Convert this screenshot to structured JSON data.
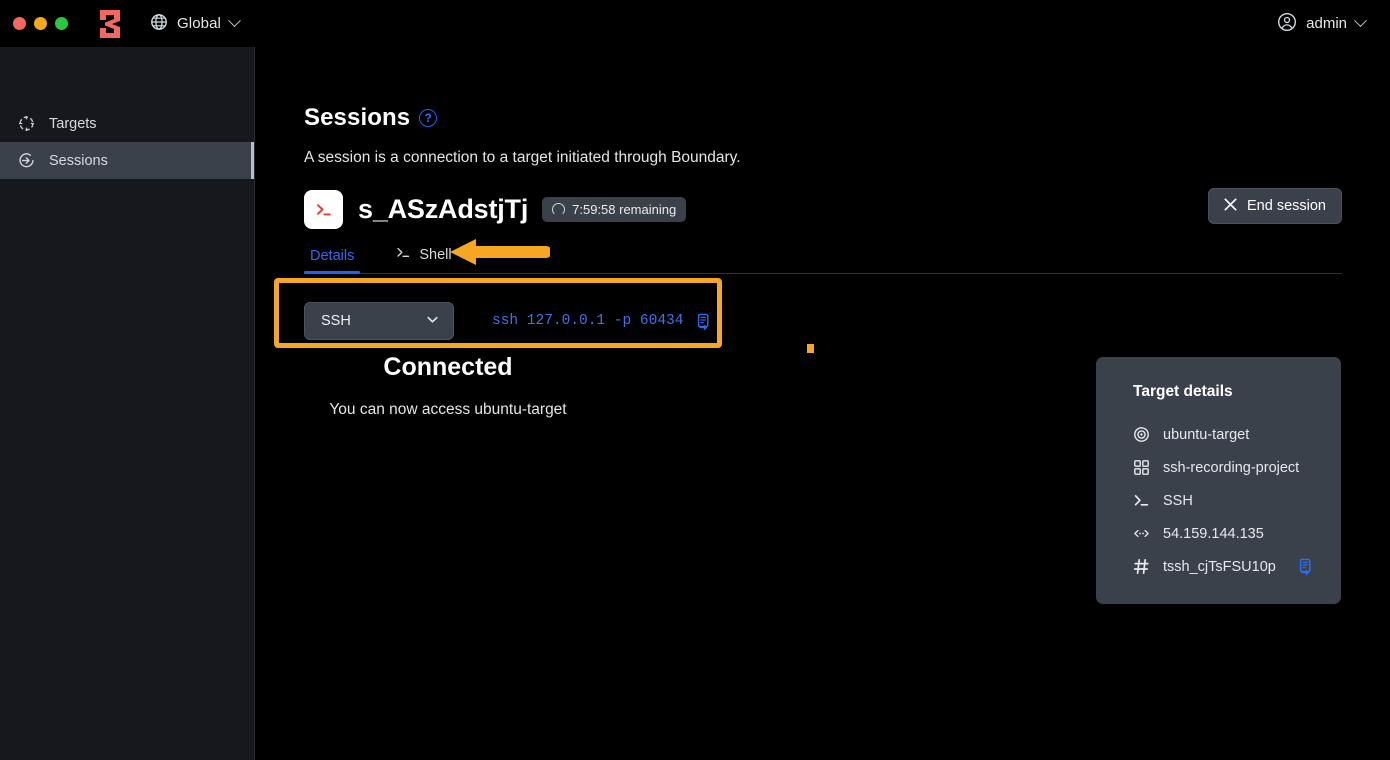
{
  "titlebar": {
    "logo_icon": "boundary-logo",
    "scope": {
      "icon": "globe-icon",
      "label": "Global",
      "chevron": "chevron-down-icon"
    },
    "user": {
      "icon": "user-circle-icon",
      "label": "admin",
      "chevron": "chevron-down-icon"
    }
  },
  "sidebar": {
    "items": [
      {
        "icon": "target-icon",
        "label": "Targets",
        "active": false
      },
      {
        "icon": "session-enter-icon",
        "label": "Sessions",
        "active": true
      }
    ]
  },
  "main": {
    "page_title": "Sessions",
    "help_badge": "?",
    "page_description": "A session is a connection to a target initiated through Boundary.",
    "session": {
      "icon": "terminal-icon",
      "id": "s_ASzAdstjTj",
      "time_badge": {
        "icon": "spinner-icon",
        "label": "7:59:58 remaining"
      },
      "end_button": {
        "icon": "close-icon",
        "label": "End session"
      }
    },
    "tabs": [
      {
        "label": "Details",
        "icon": null,
        "active": true
      },
      {
        "label": "Shell",
        "icon": "terminal-icon",
        "active": false
      }
    ],
    "connect": {
      "protocol_select": {
        "value": "SSH",
        "chevron": "chevron-down-icon"
      },
      "command": "ssh 127.0.0.1 -p 60434",
      "copy_icon": "copy-icon"
    },
    "connected": {
      "title": "Connected",
      "subtitle": "You can now access ubuntu-target"
    },
    "target_details": {
      "heading": "Target details",
      "rows": [
        {
          "icon": "target-icon",
          "value": "ubuntu-target",
          "copy": false
        },
        {
          "icon": "grid-icon",
          "value": "ssh-recording-project",
          "copy": false
        },
        {
          "icon": "terminal-icon",
          "value": "SSH",
          "copy": false
        },
        {
          "icon": "network-icon",
          "value": "54.159.144.135",
          "copy": false
        },
        {
          "icon": "hash-icon",
          "value": "tssh_cjTsFSU10p",
          "copy": true
        }
      ]
    }
  },
  "annotations": {
    "highlight_box": "connect-row-highlight",
    "arrow": "arrow-pointing-to-shell-tab",
    "color": "#f5a623"
  },
  "colors": {
    "accent_blue": "#1c64f2",
    "brand_red": "#f4685f",
    "panel": "#3b414b",
    "sidebar": "#16181d",
    "background": "#000000",
    "annotation_orange": "#f5a623"
  }
}
